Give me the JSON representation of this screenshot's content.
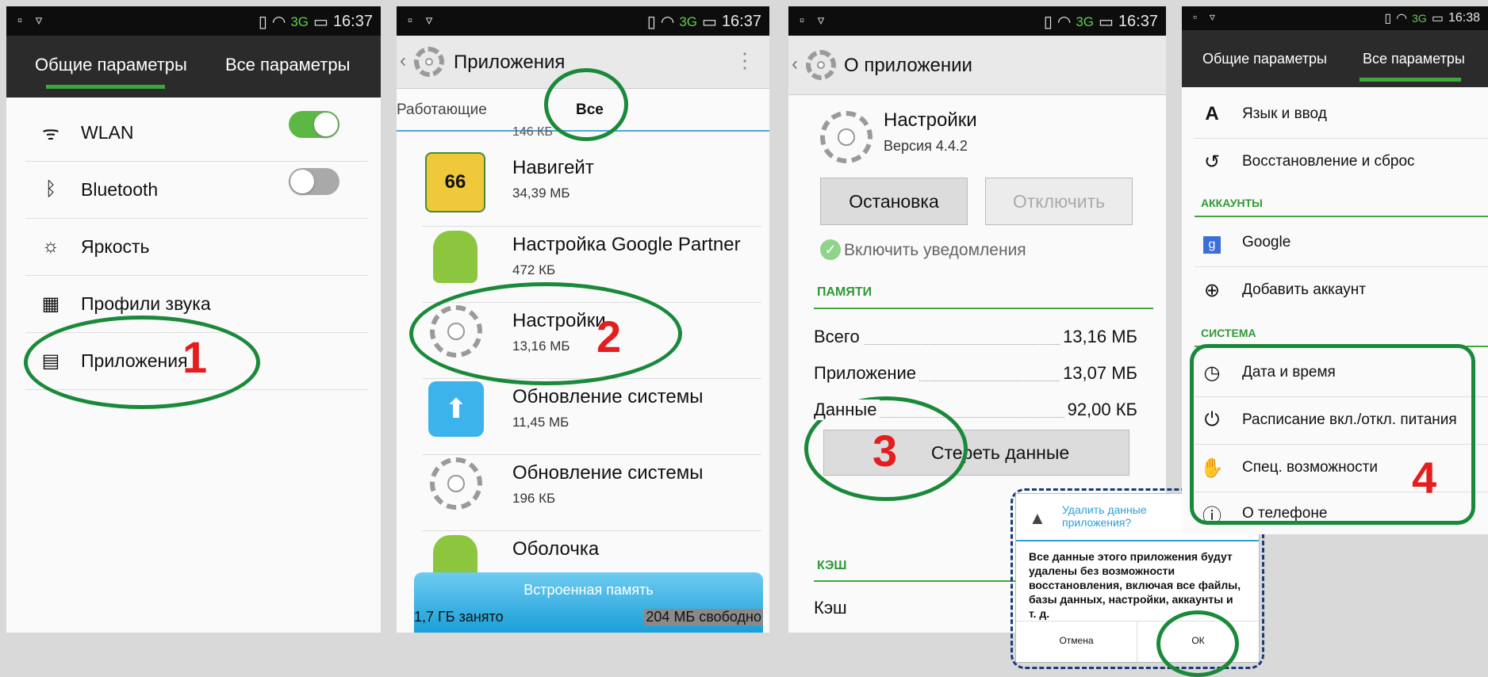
{
  "status": {
    "left_icons": "▫ ▿",
    "signal": "3G",
    "signal_icon": "signal-icon",
    "time1": "16:37",
    "time4": "16:38"
  },
  "p1": {
    "tab_general": "Общие параметры",
    "tab_all": "Все параметры",
    "items": [
      {
        "label": "WLAN",
        "icon": "wifi-icon"
      },
      {
        "label": "Bluetooth",
        "icon": "bluetooth-icon"
      },
      {
        "label": "Яркость",
        "icon": "brightness-icon"
      },
      {
        "label": "Профили звука",
        "icon": "sound-profiles-icon"
      },
      {
        "label": "Приложения",
        "icon": "apps-icon"
      }
    ],
    "step": "1"
  },
  "p2": {
    "title": "Приложения",
    "tab_running": "Работающие",
    "tab_all": "Все",
    "partial_size": "146 КБ",
    "apps": [
      {
        "name": "Навигейт",
        "size": "34,39 МБ",
        "icon": "navigate-66-icon"
      },
      {
        "name": "Настройка Google Partner",
        "size": "472 КБ",
        "icon": "android-icon"
      },
      {
        "name": "Настройки",
        "size": "13,16 МБ",
        "icon": "gear-icon"
      },
      {
        "name": "Обновление системы",
        "size": "11,45 МБ",
        "icon": "system-update-icon"
      },
      {
        "name": "Обновление системы",
        "size": "196 КБ",
        "icon": "gear-icon"
      },
      {
        "name": "Оболочка",
        "size": "",
        "icon": "android-icon"
      }
    ],
    "storage_title": "Встроенная память",
    "used": "1,7 ГБ занято",
    "free": "204 МБ свободно",
    "step": "2"
  },
  "p3": {
    "title": "О приложении",
    "app_name": "Настройки",
    "version": "Версия 4.4.2",
    "btn_stop": "Остановка",
    "btn_disable": "Отключить",
    "notify": "Включить уведомления",
    "memory_header": "ПАМЯТИ",
    "rows": [
      {
        "k": "Всего",
        "v": "13,16 МБ"
      },
      {
        "k": "Приложение",
        "v": "13,07 МБ"
      },
      {
        "k": "Данные",
        "v": "92,00 КБ"
      }
    ],
    "btn_clear": "Стереть данные",
    "cache_header": "КЭШ",
    "cache_row": "Кэш",
    "step": "3"
  },
  "dialog": {
    "title": "Удалить данные приложения?",
    "body": "Все данные этого приложения будут удалены без возможности восстановления, включая все файлы, базы данных, настройки, аккаунты и т. д.",
    "cancel": "Отмена",
    "ok": "ОК"
  },
  "p4": {
    "tab_general": "Общие параметры",
    "tab_all": "Все параметры",
    "lang": "Язык и ввод",
    "reset": "Восстановление и сброс",
    "accounts_header": "АККАУНТЫ",
    "google": "Google",
    "add_account": "Добавить аккаунт",
    "system_header": "СИСТЕМА",
    "datetime": "Дата и время",
    "schedule": "Расписание вкл./откл. питания",
    "accessibility": "Спец. возможности",
    "about": "О телефоне",
    "step": "4"
  },
  "colors": {
    "accent_green": "#3ea83a",
    "step_red": "#e41e1e",
    "circle_green": "#1a8a3a",
    "dash_blue": "#1a3a7a"
  }
}
